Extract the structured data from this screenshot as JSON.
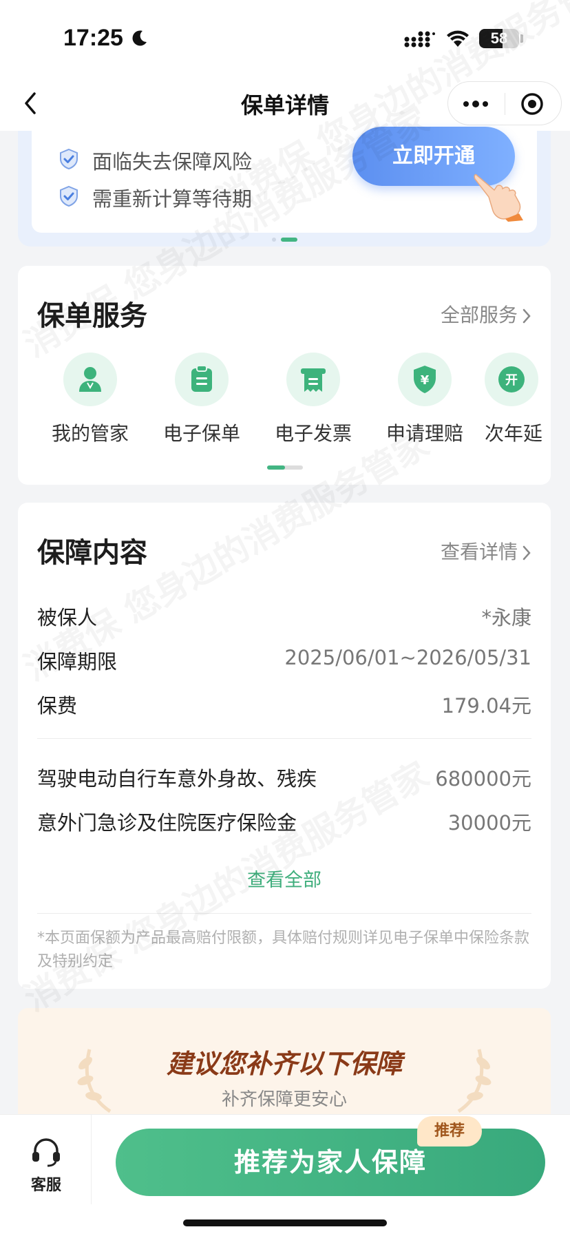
{
  "status_bar": {
    "time": "17:25",
    "battery": "58",
    "battery_level": 0.58
  },
  "nav": {
    "title": "保单详情"
  },
  "promo": {
    "items": [
      "面临失去保障风险",
      "需重新计算等待期"
    ],
    "button": "立即开通"
  },
  "services": {
    "title": "保单服务",
    "link": "全部服务",
    "items": [
      {
        "label": "我的管家",
        "icon": "butler-icon"
      },
      {
        "label": "电子保单",
        "icon": "e-policy-icon"
      },
      {
        "label": "电子发票",
        "icon": "e-invoice-icon"
      },
      {
        "label": "申请理赔",
        "icon": "claim-icon"
      },
      {
        "label": "次年延",
        "icon_text": "开",
        "icon": "renewal-icon"
      }
    ]
  },
  "coverage": {
    "title": "保障内容",
    "link": "查看详情",
    "rows": [
      {
        "key": "被保人",
        "value": "*永康"
      },
      {
        "key": "保障期限",
        "value": "2025/06/01~2026/05/31"
      },
      {
        "key": "保费",
        "value": "179.04元"
      }
    ],
    "benefits": [
      {
        "key": "驾驶电动自行车意外身故、残疾",
        "value": "680000元"
      },
      {
        "key": "意外门急诊及住院医疗保险金",
        "value": "30000元"
      }
    ],
    "see_all": "查看全部",
    "note": "*本页面保额为产品最高赔付限额，具体赔付规则详见电子保单中保险条款及特别约定"
  },
  "recommend": {
    "title": "建议您补齐以下保障",
    "subtitle": "补齐保障更安心"
  },
  "bottom": {
    "cs_label": "客服",
    "main_button": "推荐为家人保障",
    "badge": "推荐"
  },
  "watermark": "消费保 您身边的消费服务管家",
  "colors": {
    "accent_green": "#3fae7c",
    "promo_blue": "#5c8ff0",
    "recommend_brown": "#8a3a18"
  }
}
